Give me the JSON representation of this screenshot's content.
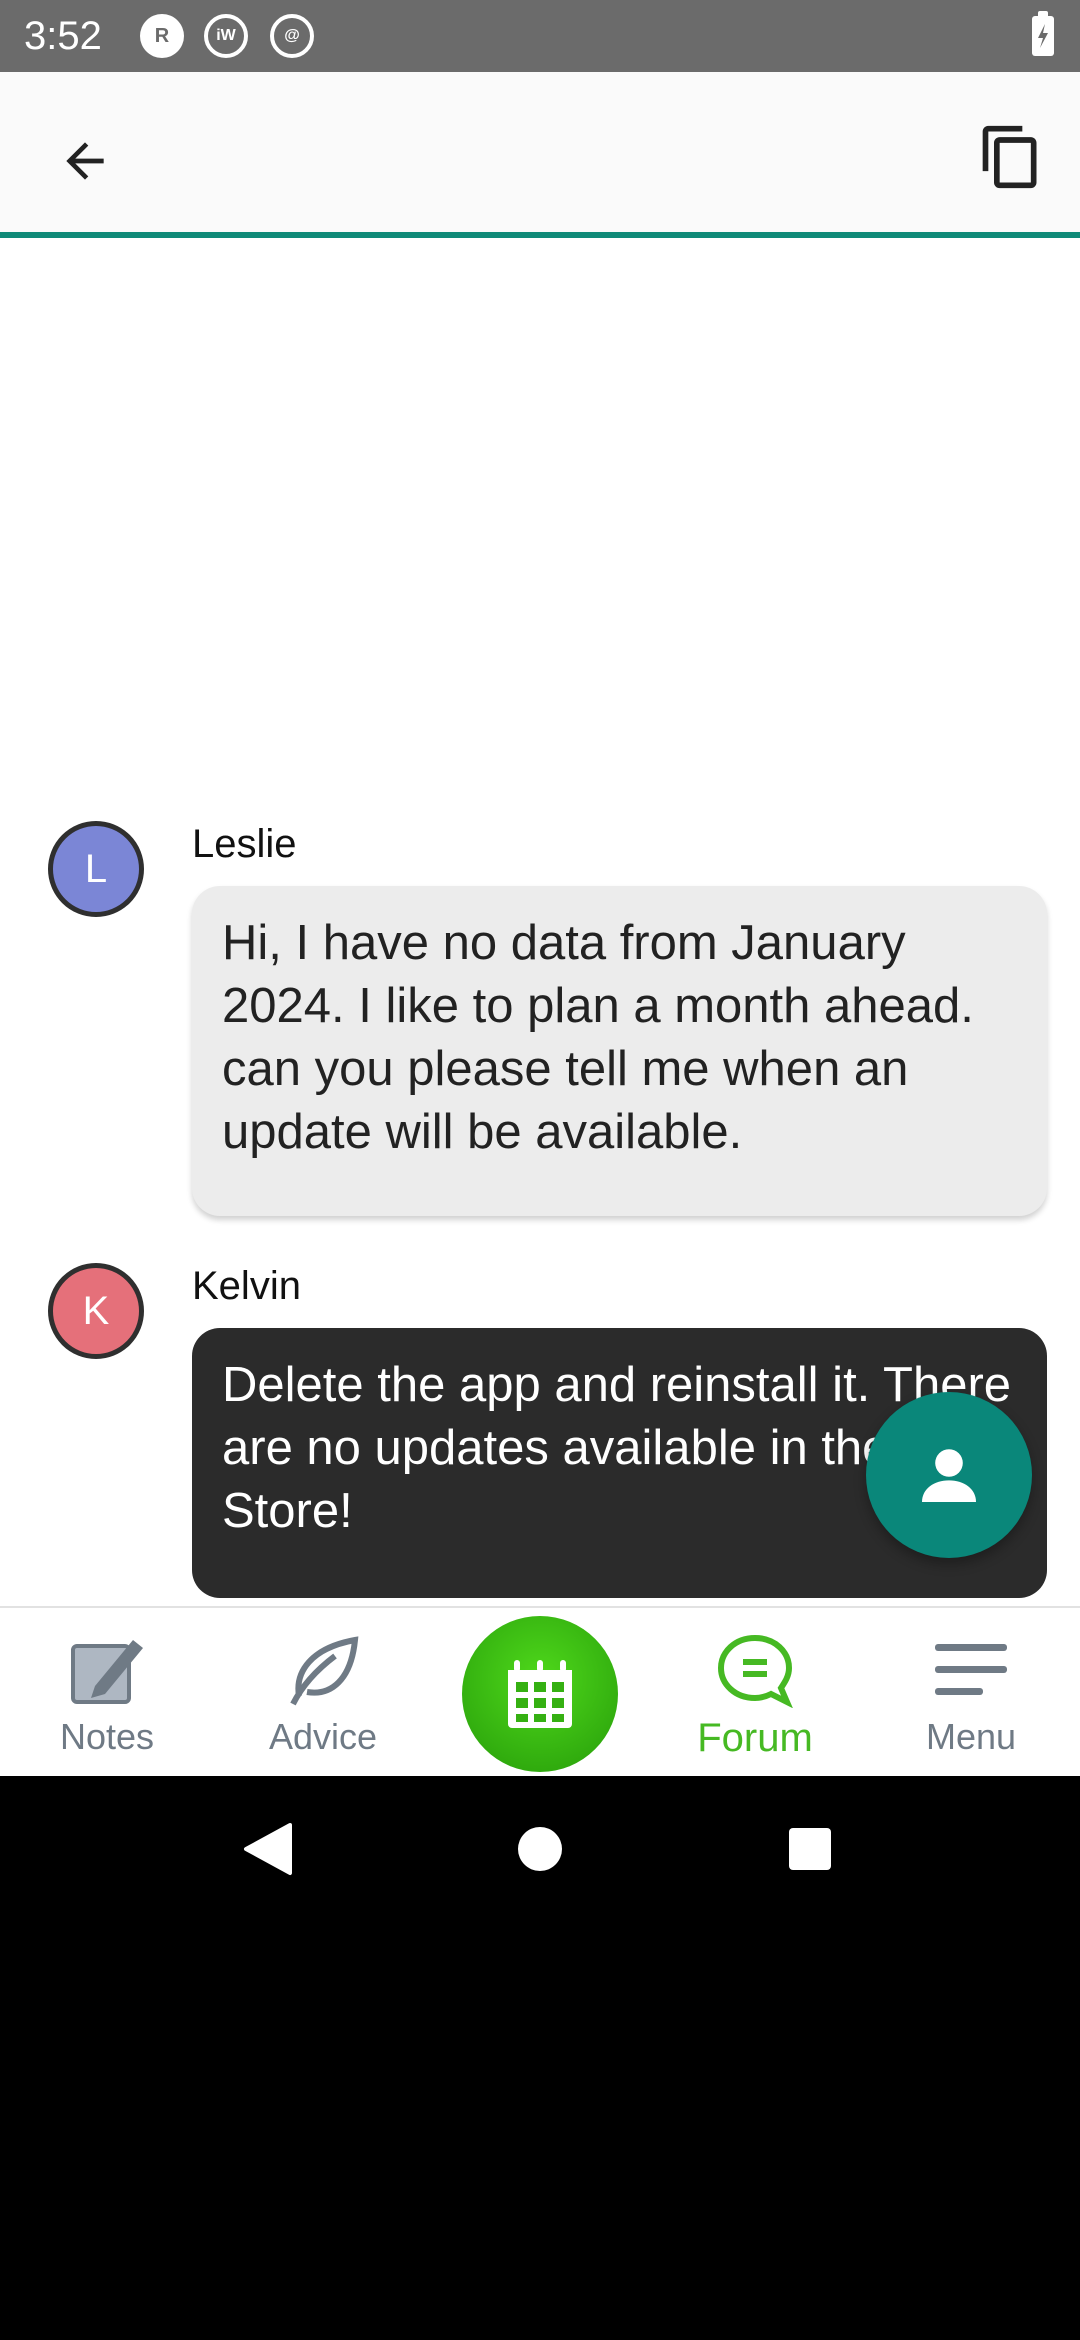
{
  "status_bar": {
    "time": "3:52",
    "icons": [
      "r-notification-icon",
      "iw-notification-icon",
      "at-notification-icon",
      "battery-charging-icon"
    ],
    "icon_letters": [
      "R",
      "iW",
      "@"
    ]
  },
  "app_bar": {
    "back_icon": "arrow-left-icon",
    "copy_icon": "copy-icon",
    "accent_color": "#0f8a78"
  },
  "messages": [
    {
      "author": "Leslie",
      "avatar_letter": "L",
      "avatar_color": "#7b86d6",
      "text": "Hi, I have no data from January 2024. I like to plan a month ahead. can you please tell me when an update will be available."
    },
    {
      "author": "Kelvin",
      "avatar_letter": "K",
      "avatar_color": "#e5707a",
      "text": "Delete the app and reinstall it. There are no updates available in the App Store!"
    }
  ],
  "fab": {
    "icon": "person-icon",
    "color": "#0a877a"
  },
  "bottom_nav": {
    "items": [
      {
        "label": "Notes",
        "icon": "notes-pencil-icon"
      },
      {
        "label": "Advice",
        "icon": "leaf-icon"
      },
      {
        "label": "",
        "icon": "calendar-icon"
      },
      {
        "label": "Forum",
        "icon": "chat-bubble-icon",
        "active": true
      },
      {
        "label": "Menu",
        "icon": "hamburger-menu-icon"
      }
    ],
    "active_color": "#46b923"
  },
  "system_nav": {
    "icons": [
      "back-triangle-icon",
      "home-circle-icon",
      "recents-square-icon"
    ]
  }
}
